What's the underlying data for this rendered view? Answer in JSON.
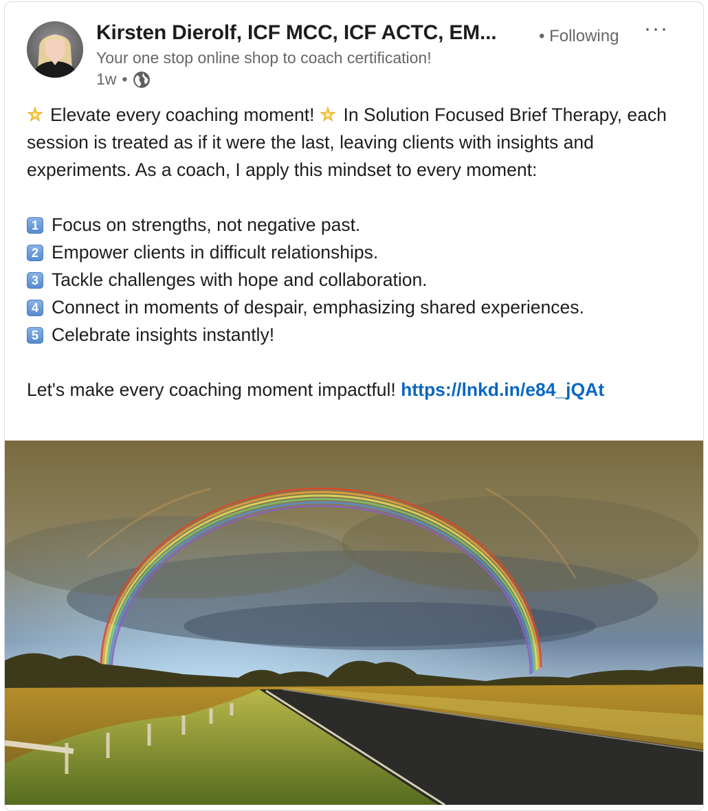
{
  "post": {
    "author_name": "Kirsten Dierolf, ICF MCC, ICF ACTC, EM...",
    "follow_status": "• Following",
    "more_label": "···",
    "tagline": "Your one stop online shop to coach certification!",
    "age": "1w",
    "age_separator": "•",
    "visibility_icon": "globe-icon",
    "intro_emoji_icon": "glowing-star-icon",
    "intro_part1": "Elevate every coaching moment!",
    "intro_part2": "In Solution Focused Brief Therapy, each session is treated as if it were the last, leaving clients with insights and experiments. As a coach, I apply this mindset to every moment:",
    "list": [
      {
        "num": "1",
        "text": "Focus on strengths, not negative past."
      },
      {
        "num": "2",
        "text": "Empower clients in difficult relationships."
      },
      {
        "num": "3",
        "text": "Tackle challenges with hope and collaboration."
      },
      {
        "num": "4",
        "text": "Connect in moments of despair, emphasizing shared experiences."
      },
      {
        "num": "5",
        "text": "Celebrate insights instantly!"
      }
    ],
    "closing": "Let's make every coaching moment impactful!",
    "link": "https://lnkd.in/e84_jQAt"
  },
  "colors": {
    "link": "#0a66c2",
    "text": "#1d1d1d",
    "muted": "#666666"
  }
}
